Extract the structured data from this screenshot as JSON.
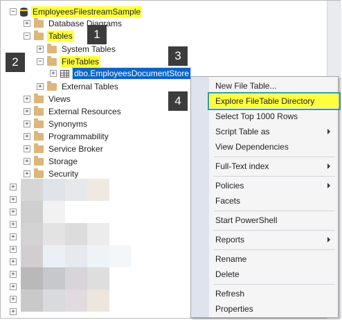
{
  "tree": {
    "database": "EmployeesFilestreamSample",
    "items": [
      {
        "expander": "+",
        "label": "Database Diagrams"
      },
      {
        "expander": "−",
        "label": "Tables"
      },
      {
        "expander": "+",
        "label": "System Tables"
      },
      {
        "expander": "−",
        "label": "FileTables"
      },
      {
        "expander": "+",
        "label": "dbo.EmployeesDocumentStore"
      },
      {
        "expander": "+",
        "label": "External Tables"
      },
      {
        "expander": "+",
        "label": "Views"
      },
      {
        "expander": "+",
        "label": "External Resources"
      },
      {
        "expander": "+",
        "label": "Synonyms"
      },
      {
        "expander": "+",
        "label": "Programmability"
      },
      {
        "expander": "+",
        "label": "Service Broker"
      },
      {
        "expander": "+",
        "label": "Storage"
      },
      {
        "expander": "+",
        "label": "Security"
      }
    ],
    "db_expander": "−",
    "collapsed_expander": "+"
  },
  "badges": [
    "1",
    "2",
    "3",
    "4"
  ],
  "context_menu": {
    "items": [
      "New File Table...",
      "Explore FileTable Directory",
      "Select Top 1000 Rows",
      "Script Table as",
      "View Dependencies",
      "Full-Text index",
      "Policies",
      "Facets",
      "Start PowerShell",
      "Reports",
      "Rename",
      "Delete",
      "Refresh",
      "Properties"
    ]
  },
  "colors": {
    "highlight": "#ffff40",
    "selection": "#0a64c8",
    "menu_outline": "#2e9f96"
  }
}
